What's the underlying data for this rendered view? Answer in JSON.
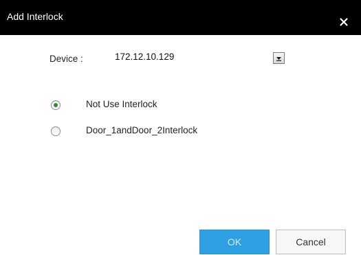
{
  "dialog": {
    "title": "Add Interlock",
    "close_icon": "close-icon"
  },
  "device": {
    "label": "Device :",
    "selected_value": "172.12.10.129",
    "dropdown_icon": "chevron-down-icon"
  },
  "interlock_options": [
    {
      "label": "Not Use Interlock",
      "selected": true
    },
    {
      "label": "Door_1andDoor_2Interlock",
      "selected": false
    }
  ],
  "buttons": {
    "ok_label": "OK",
    "cancel_label": "Cancel"
  },
  "colors": {
    "titlebar": "#000000",
    "ok_button": "#2f9fe4",
    "radio_selected": "#2e8b2e"
  }
}
